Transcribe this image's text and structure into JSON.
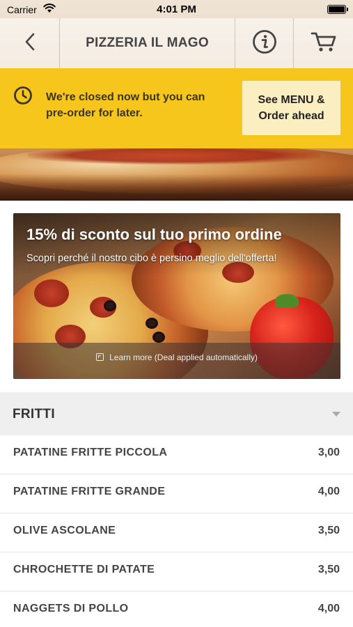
{
  "status_bar": {
    "carrier": "Carrier",
    "time": "4:01 PM"
  },
  "nav": {
    "title": "PIZZERIA IL MAGO",
    "back_icon": "chevron-left-icon",
    "info_icon": "info-icon",
    "cart_icon": "cart-icon"
  },
  "notice": {
    "icon": "clock-icon",
    "text_line1": "We're closed now but you can",
    "text_line2": "pre-order for later.",
    "button_line1": "See MENU &",
    "button_line2": "Order ahead",
    "color": "#f7c61c"
  },
  "promo": {
    "title": "15% di sconto sul tuo primo ordine",
    "subtitle": "Scopri perché il nostro cibo è persino meglio dell'offerta!",
    "link": "Learn more (Deal applied automatically)"
  },
  "category": {
    "title": "FRITTI"
  },
  "menu_items": [
    {
      "name": "PATATINE FRITTE PICCOLA",
      "price": "3,00"
    },
    {
      "name": "PATATINE FRITTE GRANDE",
      "price": "4,00"
    },
    {
      "name": "OLIVE ASCOLANE",
      "price": "3,50"
    },
    {
      "name": "CHROCHETTE DI PATATE",
      "price": "3,50"
    },
    {
      "name": "NAGGETS DI POLLO",
      "price": "4,00"
    }
  ]
}
